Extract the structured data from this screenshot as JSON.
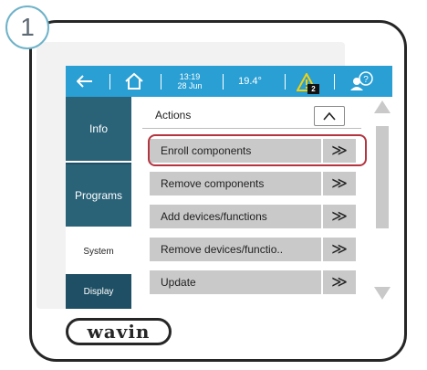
{
  "step": {
    "number": "1"
  },
  "colors": {
    "accent": "#2a9fd4",
    "sidebar": "#2a6278",
    "highlight": "#b4343f",
    "row": "#c9c9c9"
  },
  "topbar": {
    "back_icon": "arrow-left-icon",
    "home_icon": "home-icon",
    "time": "13:19",
    "date": "28 Jun",
    "temperature": "19.4°",
    "warning_icon": "warning-triangle-icon",
    "warning_count": "2",
    "help_icon": "user-help-icon"
  },
  "sidebar": {
    "items": [
      {
        "label": "Info"
      },
      {
        "label": "Programs"
      },
      {
        "label": "System",
        "active": true
      },
      {
        "label": "Display"
      }
    ]
  },
  "main": {
    "section_label": "Actions",
    "collapse_icon": "chevron-up-icon",
    "actions": [
      {
        "label": "Enroll components",
        "icon": "double-chevron-right-icon",
        "highlighted": true
      },
      {
        "label": "Remove components",
        "icon": "double-chevron-right-icon"
      },
      {
        "label": "Add devices/functions",
        "icon": "double-chevron-right-icon"
      },
      {
        "label": "Remove devices/functio..",
        "icon": "double-chevron-right-icon"
      },
      {
        "label": "Update",
        "icon": "double-chevron-right-icon"
      }
    ]
  },
  "brand": {
    "logo_text": "wavin"
  }
}
